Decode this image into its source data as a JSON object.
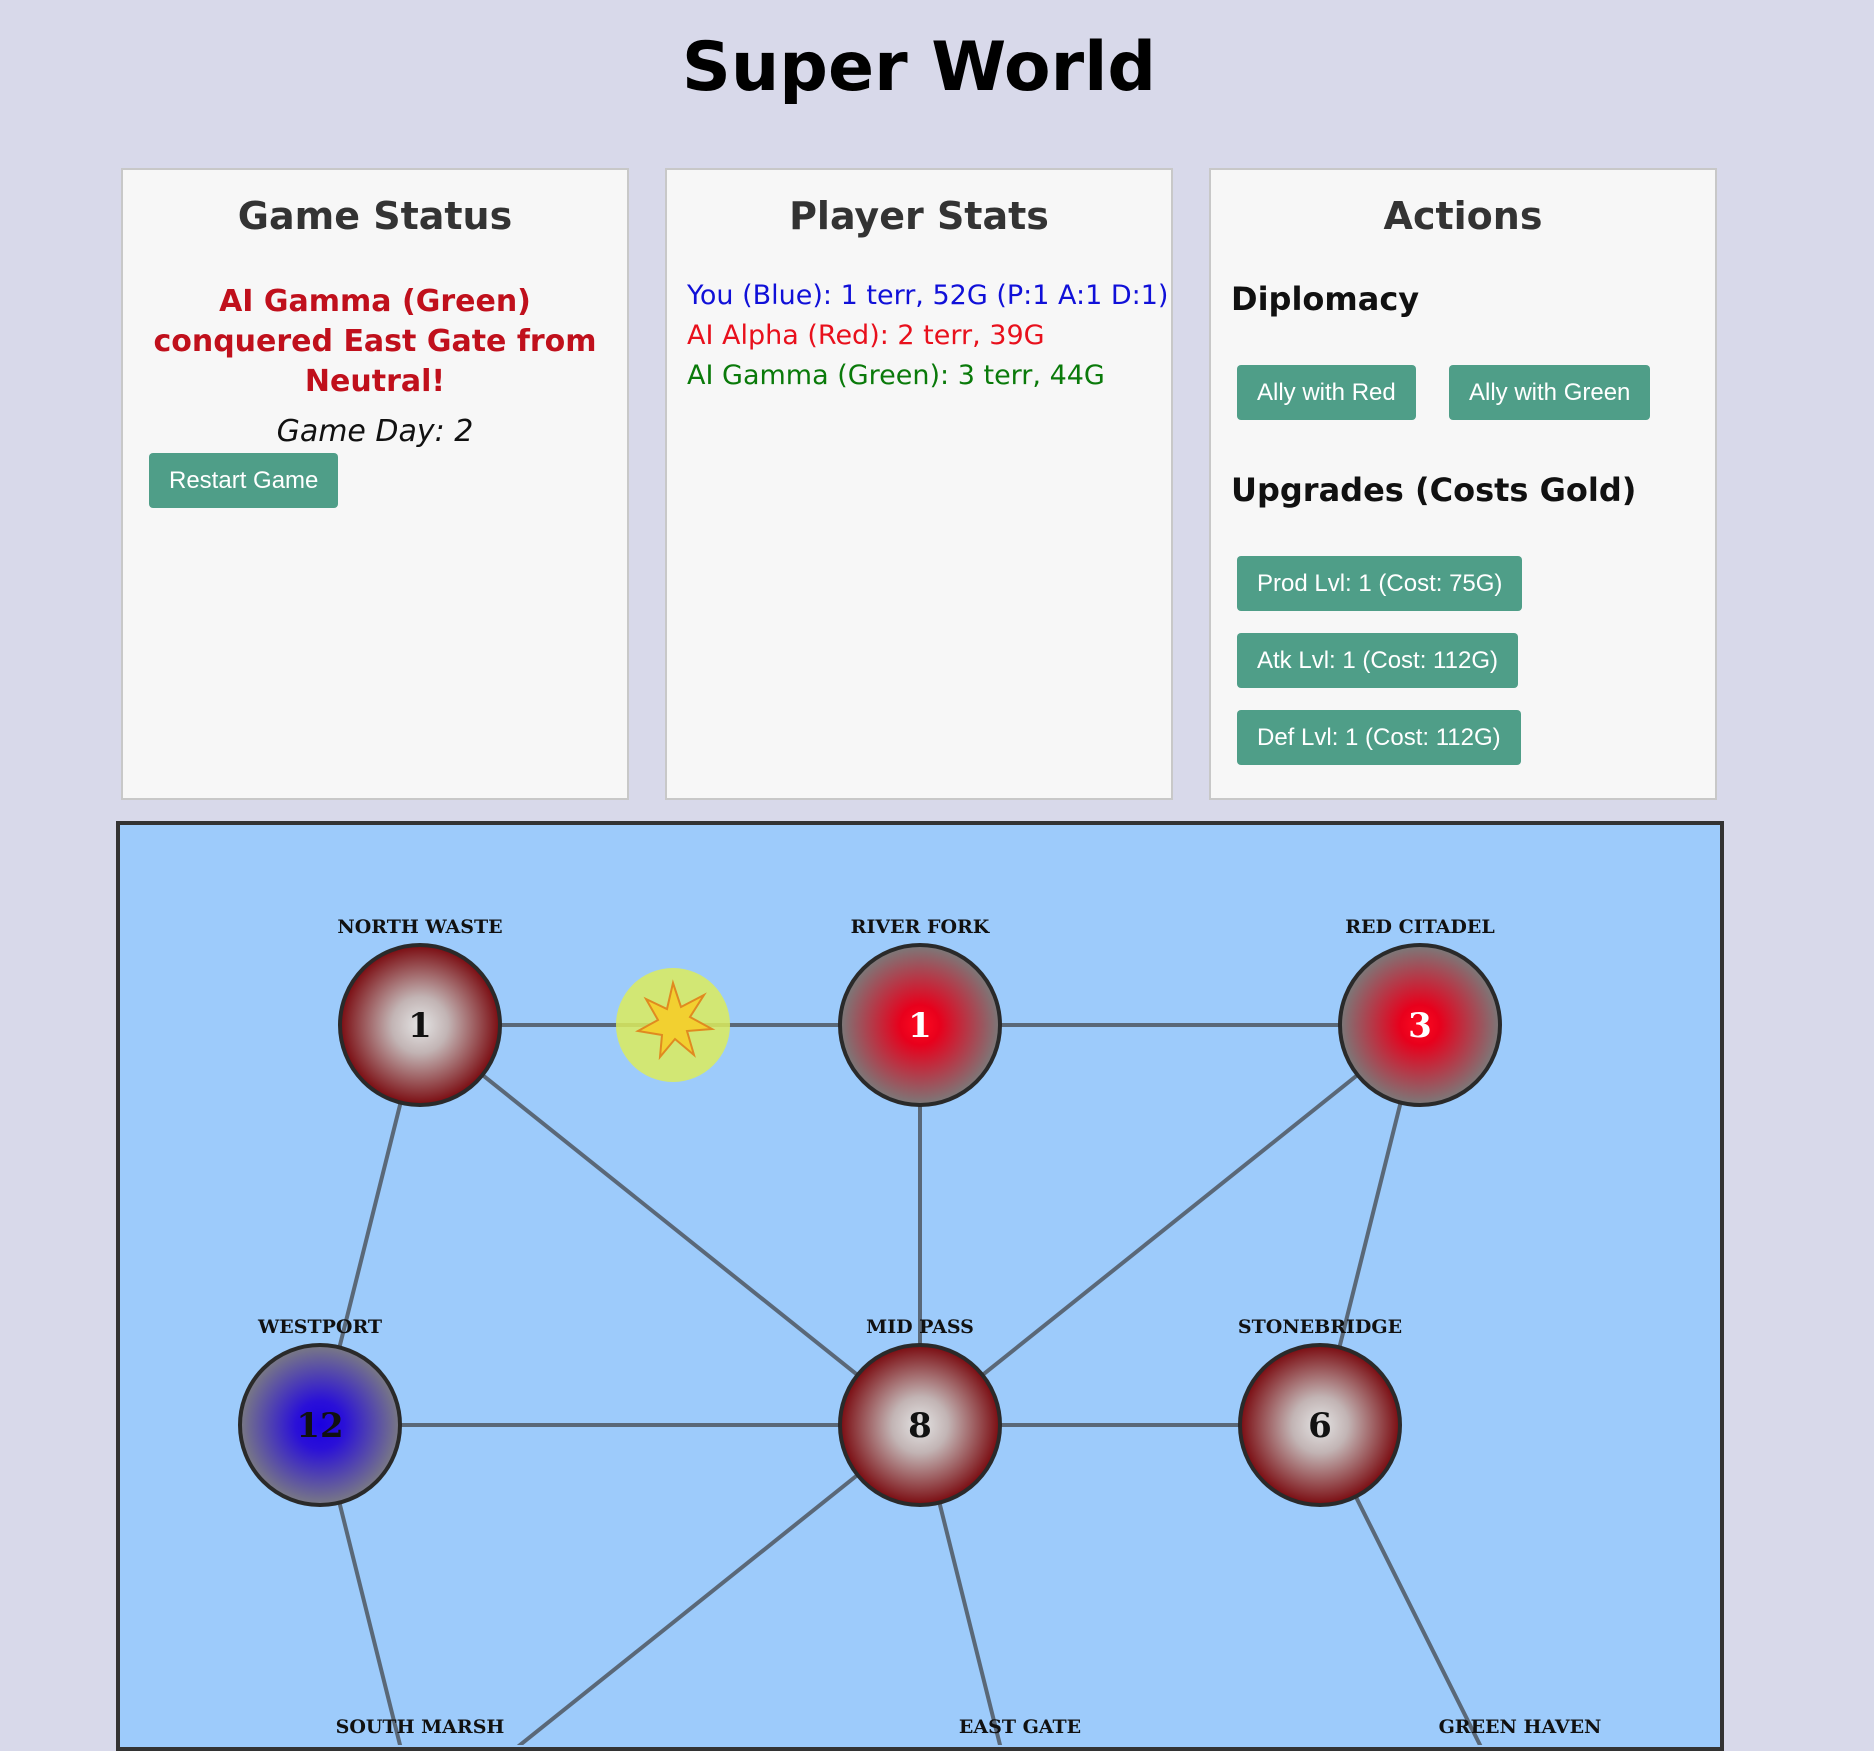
{
  "title": "Super World",
  "game_status": {
    "heading": "Game Status",
    "message": "AI Gamma (Green) conquered East Gate from Neutral!",
    "day": "Game Day: 2",
    "restart_label": "Restart Game"
  },
  "player_stats": {
    "heading": "Player Stats",
    "lines": [
      {
        "text": "You (Blue): 1 terr, 52G (P:1 A:1 D:1)",
        "color": "#1010d8"
      },
      {
        "text": "AI Alpha (Red): 2 terr, 39G",
        "color": "#e8101c"
      },
      {
        "text": "AI Gamma (Green): 3 terr, 44G",
        "color": "#0a7a0a"
      }
    ]
  },
  "actions": {
    "heading": "Actions",
    "diplomacy_heading": "Diplomacy",
    "ally_red_label": "Ally with Red",
    "ally_green_label": "Ally with Green",
    "upgrades_heading": "Upgrades (Costs Gold)",
    "prod_label": "Prod Lvl: 1 (Cost: 75G)",
    "atk_label": "Atk Lvl: 1 (Cost: 112G)",
    "def_label": "Def Lvl: 1 (Cost: 112G)"
  },
  "colors": {
    "button": "#4f9e88",
    "map_background": "#9dcbfb",
    "blue_owner": "#1a00e0",
    "red_owner": "#e8001c",
    "neutral_owner": "#7a0b10"
  },
  "map": {
    "territories": [
      {
        "id": "north-waste",
        "name": "NORTH WASTE",
        "troops": "1",
        "owner": "neutral"
      },
      {
        "id": "river-fork",
        "name": "RIVER FORK",
        "troops": "1",
        "owner": "red"
      },
      {
        "id": "red-citadel",
        "name": "RED CITADEL",
        "troops": "3",
        "owner": "red"
      },
      {
        "id": "westport",
        "name": "WESTPORT",
        "troops": "12",
        "owner": "blue"
      },
      {
        "id": "mid-pass",
        "name": "MID PASS",
        "troops": "8",
        "owner": "neutral"
      },
      {
        "id": "stonebridge",
        "name": "STONEBRIDGE",
        "troops": "6",
        "owner": "neutral"
      },
      {
        "id": "south-marsh",
        "name": "SOUTH MARSH",
        "troops": "",
        "owner": "neutral"
      },
      {
        "id": "east-gate",
        "name": "EAST GATE",
        "troops": "",
        "owner": "green"
      },
      {
        "id": "green-haven",
        "name": "GREEN HAVEN",
        "troops": "",
        "owner": "green"
      }
    ],
    "connections": [
      [
        "north-waste",
        "river-fork"
      ],
      [
        "river-fork",
        "red-citadel"
      ],
      [
        "north-waste",
        "westport"
      ],
      [
        "north-waste",
        "mid-pass"
      ],
      [
        "river-fork",
        "mid-pass"
      ],
      [
        "red-citadel",
        "mid-pass"
      ],
      [
        "red-citadel",
        "stonebridge"
      ],
      [
        "westport",
        "mid-pass"
      ],
      [
        "mid-pass",
        "stonebridge"
      ],
      [
        "westport",
        "south-marsh"
      ],
      [
        "mid-pass",
        "south-marsh-east"
      ],
      [
        "mid-pass",
        "east-gate"
      ],
      [
        "stonebridge",
        "green-haven"
      ]
    ]
  }
}
